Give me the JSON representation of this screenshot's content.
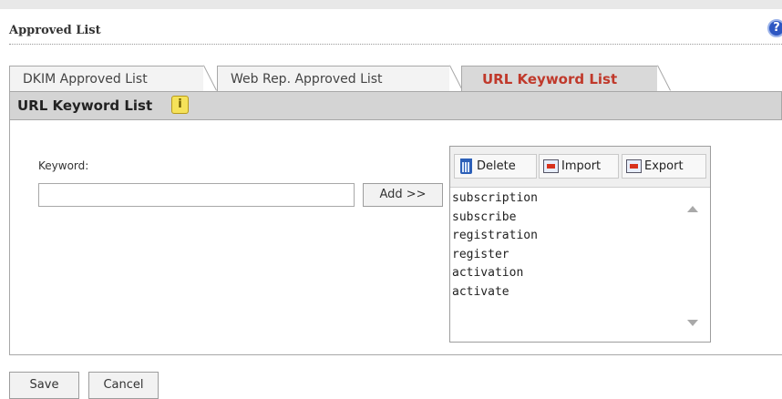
{
  "page": {
    "title": "Approved List",
    "help_icon": "help-icon"
  },
  "tabs": [
    {
      "label": "DKIM Approved List",
      "active": false
    },
    {
      "label": "Web Rep. Approved List",
      "active": false
    },
    {
      "label": "URL Keyword List",
      "active": true
    }
  ],
  "section": {
    "title": "URL Keyword List",
    "info_icon": "info-icon"
  },
  "form": {
    "keyword_label": "Keyword:",
    "keyword_value": "",
    "add_label": "Add >>"
  },
  "list": {
    "toolbar": {
      "delete_label": "Delete",
      "import_label": "Import",
      "export_label": "Export"
    },
    "items": [
      "subscription",
      "subscribe",
      "registration",
      "register",
      "activation",
      "activate"
    ]
  },
  "actions": {
    "save_label": "Save",
    "cancel_label": "Cancel"
  },
  "colors": {
    "active_tab_text": "#c0392b",
    "header_bg": "#d4d4d4",
    "help_icon": "#2d57c2"
  }
}
